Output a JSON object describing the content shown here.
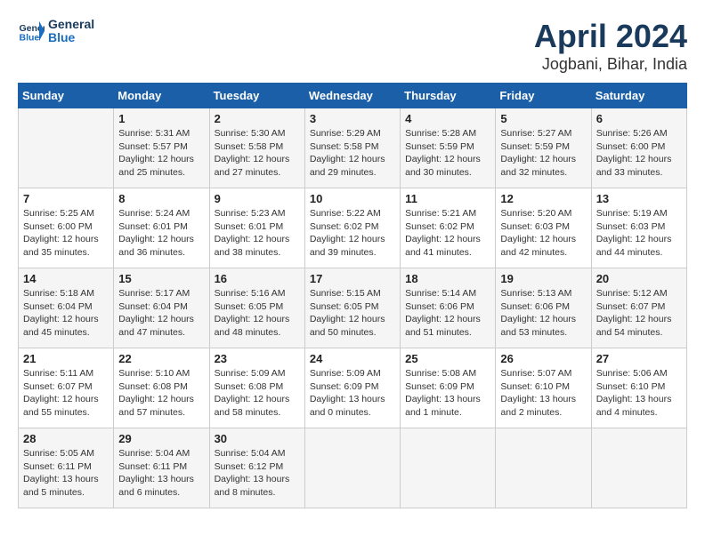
{
  "header": {
    "logo_text_general": "General",
    "logo_text_blue": "Blue",
    "month_year": "April 2024",
    "location": "Jogbani, Bihar, India"
  },
  "days_of_week": [
    "Sunday",
    "Monday",
    "Tuesday",
    "Wednesday",
    "Thursday",
    "Friday",
    "Saturday"
  ],
  "weeks": [
    [
      {
        "day": "",
        "info": ""
      },
      {
        "day": "1",
        "info": "Sunrise: 5:31 AM\nSunset: 5:57 PM\nDaylight: 12 hours\nand 25 minutes."
      },
      {
        "day": "2",
        "info": "Sunrise: 5:30 AM\nSunset: 5:58 PM\nDaylight: 12 hours\nand 27 minutes."
      },
      {
        "day": "3",
        "info": "Sunrise: 5:29 AM\nSunset: 5:58 PM\nDaylight: 12 hours\nand 29 minutes."
      },
      {
        "day": "4",
        "info": "Sunrise: 5:28 AM\nSunset: 5:59 PM\nDaylight: 12 hours\nand 30 minutes."
      },
      {
        "day": "5",
        "info": "Sunrise: 5:27 AM\nSunset: 5:59 PM\nDaylight: 12 hours\nand 32 minutes."
      },
      {
        "day": "6",
        "info": "Sunrise: 5:26 AM\nSunset: 6:00 PM\nDaylight: 12 hours\nand 33 minutes."
      }
    ],
    [
      {
        "day": "7",
        "info": "Sunrise: 5:25 AM\nSunset: 6:00 PM\nDaylight: 12 hours\nand 35 minutes."
      },
      {
        "day": "8",
        "info": "Sunrise: 5:24 AM\nSunset: 6:01 PM\nDaylight: 12 hours\nand 36 minutes."
      },
      {
        "day": "9",
        "info": "Sunrise: 5:23 AM\nSunset: 6:01 PM\nDaylight: 12 hours\nand 38 minutes."
      },
      {
        "day": "10",
        "info": "Sunrise: 5:22 AM\nSunset: 6:02 PM\nDaylight: 12 hours\nand 39 minutes."
      },
      {
        "day": "11",
        "info": "Sunrise: 5:21 AM\nSunset: 6:02 PM\nDaylight: 12 hours\nand 41 minutes."
      },
      {
        "day": "12",
        "info": "Sunrise: 5:20 AM\nSunset: 6:03 PM\nDaylight: 12 hours\nand 42 minutes."
      },
      {
        "day": "13",
        "info": "Sunrise: 5:19 AM\nSunset: 6:03 PM\nDaylight: 12 hours\nand 44 minutes."
      }
    ],
    [
      {
        "day": "14",
        "info": "Sunrise: 5:18 AM\nSunset: 6:04 PM\nDaylight: 12 hours\nand 45 minutes."
      },
      {
        "day": "15",
        "info": "Sunrise: 5:17 AM\nSunset: 6:04 PM\nDaylight: 12 hours\nand 47 minutes."
      },
      {
        "day": "16",
        "info": "Sunrise: 5:16 AM\nSunset: 6:05 PM\nDaylight: 12 hours\nand 48 minutes."
      },
      {
        "day": "17",
        "info": "Sunrise: 5:15 AM\nSunset: 6:05 PM\nDaylight: 12 hours\nand 50 minutes."
      },
      {
        "day": "18",
        "info": "Sunrise: 5:14 AM\nSunset: 6:06 PM\nDaylight: 12 hours\nand 51 minutes."
      },
      {
        "day": "19",
        "info": "Sunrise: 5:13 AM\nSunset: 6:06 PM\nDaylight: 12 hours\nand 53 minutes."
      },
      {
        "day": "20",
        "info": "Sunrise: 5:12 AM\nSunset: 6:07 PM\nDaylight: 12 hours\nand 54 minutes."
      }
    ],
    [
      {
        "day": "21",
        "info": "Sunrise: 5:11 AM\nSunset: 6:07 PM\nDaylight: 12 hours\nand 55 minutes."
      },
      {
        "day": "22",
        "info": "Sunrise: 5:10 AM\nSunset: 6:08 PM\nDaylight: 12 hours\nand 57 minutes."
      },
      {
        "day": "23",
        "info": "Sunrise: 5:09 AM\nSunset: 6:08 PM\nDaylight: 12 hours\nand 58 minutes."
      },
      {
        "day": "24",
        "info": "Sunrise: 5:09 AM\nSunset: 6:09 PM\nDaylight: 13 hours\nand 0 minutes."
      },
      {
        "day": "25",
        "info": "Sunrise: 5:08 AM\nSunset: 6:09 PM\nDaylight: 13 hours\nand 1 minute."
      },
      {
        "day": "26",
        "info": "Sunrise: 5:07 AM\nSunset: 6:10 PM\nDaylight: 13 hours\nand 2 minutes."
      },
      {
        "day": "27",
        "info": "Sunrise: 5:06 AM\nSunset: 6:10 PM\nDaylight: 13 hours\nand 4 minutes."
      }
    ],
    [
      {
        "day": "28",
        "info": "Sunrise: 5:05 AM\nSunset: 6:11 PM\nDaylight: 13 hours\nand 5 minutes."
      },
      {
        "day": "29",
        "info": "Sunrise: 5:04 AM\nSunset: 6:11 PM\nDaylight: 13 hours\nand 6 minutes."
      },
      {
        "day": "30",
        "info": "Sunrise: 5:04 AM\nSunset: 6:12 PM\nDaylight: 13 hours\nand 8 minutes."
      },
      {
        "day": "",
        "info": ""
      },
      {
        "day": "",
        "info": ""
      },
      {
        "day": "",
        "info": ""
      },
      {
        "day": "",
        "info": ""
      }
    ]
  ]
}
